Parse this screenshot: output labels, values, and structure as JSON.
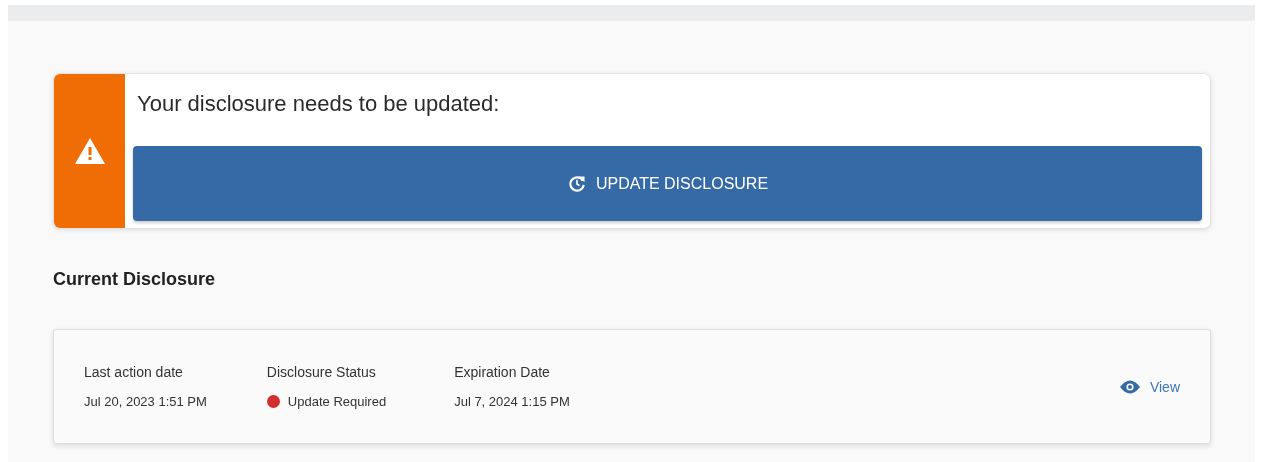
{
  "alert": {
    "message": "Your disclosure needs to be updated:",
    "button": "UPDATE DISCLOSURE"
  },
  "section_title": "Current Disclosure",
  "disclosure": {
    "fields": [
      {
        "label": "Last action date",
        "value": "Jul 20, 2023 1:51 PM"
      },
      {
        "label": "Disclosure Status",
        "value": "Update Required",
        "color": "#d32f2f"
      },
      {
        "label": "Expiration Date",
        "value": "Jul 7, 2024 1:15 PM"
      }
    ],
    "action": "View"
  }
}
